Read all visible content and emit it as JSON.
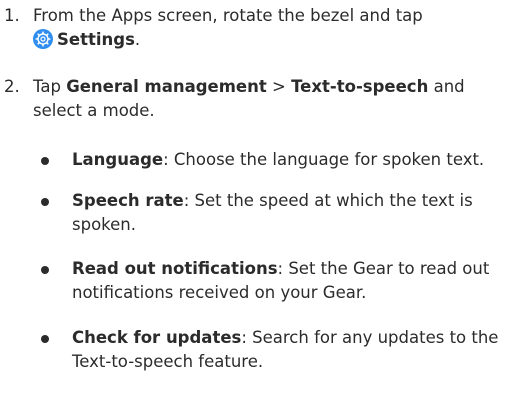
{
  "steps": [
    {
      "number": "1.",
      "text_before": "From the Apps screen, rotate the bezel and tap",
      "icon": "settings-gear-icon",
      "bold_label": "Settings",
      "text_after": "."
    },
    {
      "number": "2.",
      "text_before": "Tap ",
      "bold_1": "General management",
      "separator": " > ",
      "bold_2": "Text-to-speech",
      "text_after": " and select a mode."
    }
  ],
  "bullets": [
    {
      "term": "Language",
      "description": ": Choose the language for spoken text."
    },
    {
      "term": "Speech rate",
      "description": ": Set the speed at which the text is spoken."
    },
    {
      "term": "Read out notifications",
      "description": ": Set the Gear to read out notifications received on your Gear."
    },
    {
      "term": "Check for updates",
      "description": ": Search for any updates to the Text-to-speech feature."
    }
  ],
  "colors": {
    "text": "#2b2b2b",
    "icon_bg": "#2f8df0"
  }
}
